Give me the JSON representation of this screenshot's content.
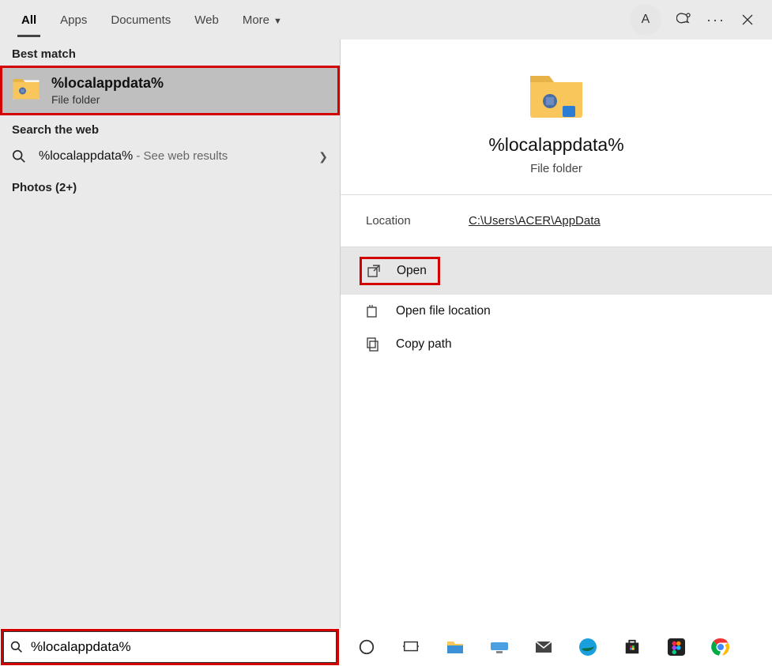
{
  "tabs": {
    "all": "All",
    "apps": "Apps",
    "documents": "Documents",
    "web": "Web",
    "more": "More"
  },
  "avatar_letter": "A",
  "left": {
    "best_match_label": "Best match",
    "best_match_item": {
      "title": "%localappdata%",
      "subtitle": "File folder"
    },
    "search_web_label": "Search the web",
    "web_item": {
      "query": "%localappdata%",
      "suffix": " - See web results"
    },
    "photos_label": "Photos (2+)"
  },
  "preview": {
    "title": "%localappdata%",
    "subtitle": "File folder",
    "location_label": "Location",
    "location_value": "C:\\Users\\ACER\\AppData",
    "actions": {
      "open": "Open",
      "open_loc": "Open file location",
      "copy_path": "Copy path"
    }
  },
  "search_value": "%localappdata%"
}
